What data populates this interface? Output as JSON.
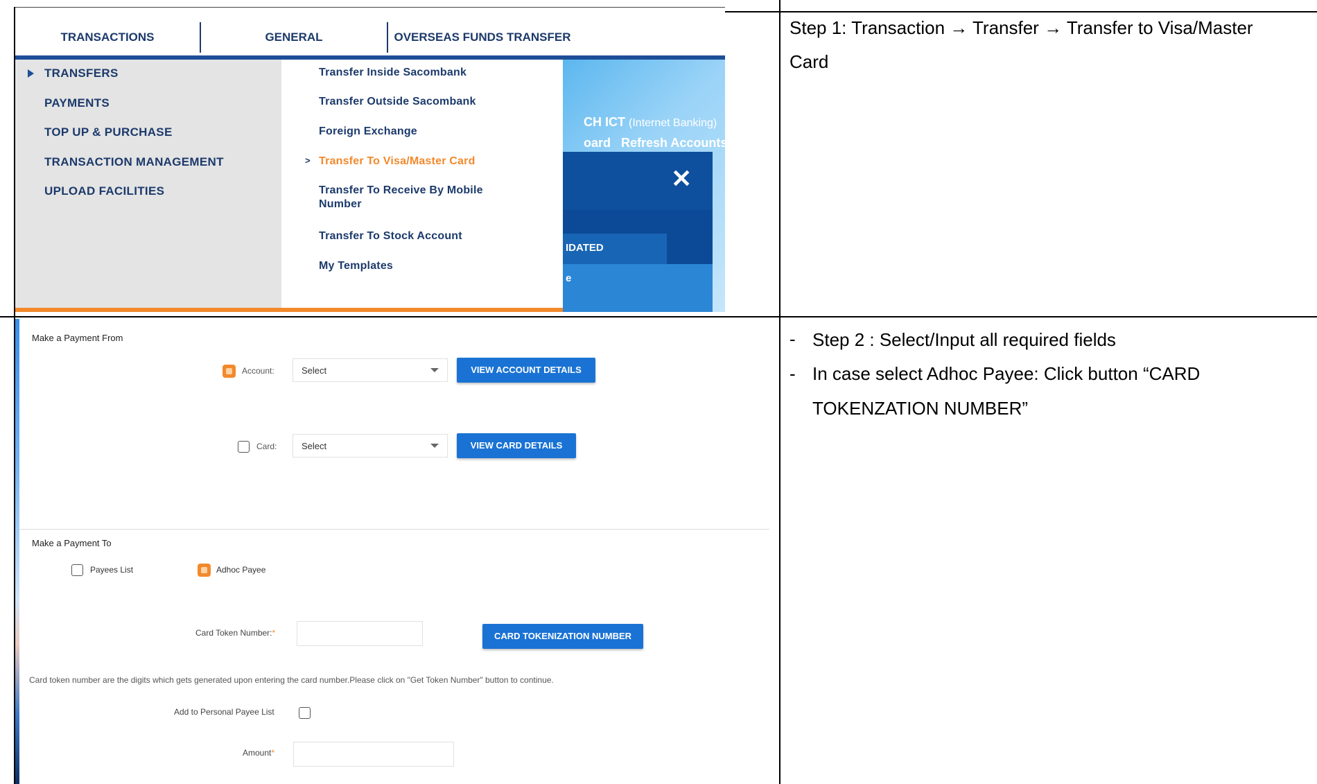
{
  "step1": {
    "nav_tabs": [
      "TRANSACTIONS",
      "GENERAL",
      "OVERSEAS FUNDS TRANSFER"
    ],
    "left_menu": [
      "TRANSFERS",
      "PAYMENTS",
      "TOP UP & PURCHASE",
      "TRANSACTION MANAGEMENT",
      "UPLOAD FACILITIES"
    ],
    "right_menu": [
      "Transfer Inside Sacombank",
      "Transfer Outside Sacombank",
      "Foreign Exchange",
      "Transfer To Visa/Master Card",
      "Transfer To Receive By Mobile",
      "Number",
      "Transfer To Stock Account",
      "My Templates"
    ],
    "active_item": "Transfer To Visa/Master Card",
    "bg_text_1": "CH ICT",
    "bg_text_2": "(Internet Banking)",
    "bg_text_3": "oard",
    "bg_text_4": "Refresh Accounts",
    "bg_text_5": "IDATED",
    "bg_text_6": "e",
    "close_glyph": "✕"
  },
  "step1_instruction": {
    "step_label": "Step 1",
    "text_line1": ": Transaction → Transfer → Transfer to Visa/Master",
    "text_line2": "Card"
  },
  "step2": {
    "from_title": "Make a Payment From",
    "account_label": "Account:",
    "account_select": "Select",
    "view_account_btn": "VIEW ACCOUNT DETAILS",
    "card_label": "Card:",
    "card_select": "Select",
    "view_card_btn": "VIEW CARD DETAILS",
    "to_title": "Make a Payment To",
    "payees_list": "Payees List",
    "adhoc_payee": "Adhoc Payee",
    "token_label": "Card Token Number:",
    "token_req": "*",
    "token_btn": "CARD TOKENIZATION NUMBER",
    "token_help": "Card token number are the digits which gets generated upon entering the card number.Please click on \"Get Token Number\" button to continue.",
    "add_payee_label": "Add to Personal Payee List",
    "amount_label": "Amount",
    "amount_req": "*"
  },
  "step2_instruction": {
    "dash": "-",
    "line1_step": "Step 2",
    "line1_text": " : Select/Input all required fields",
    "line2": "In case select Adhoc Payee: Click button “CARD",
    "line3": "TOKENZATION NUMBER”"
  },
  "colors": {
    "accent_orange": "#f2892c",
    "nav_blue": "#1c3a6b",
    "button_blue": "#1a73d4"
  }
}
